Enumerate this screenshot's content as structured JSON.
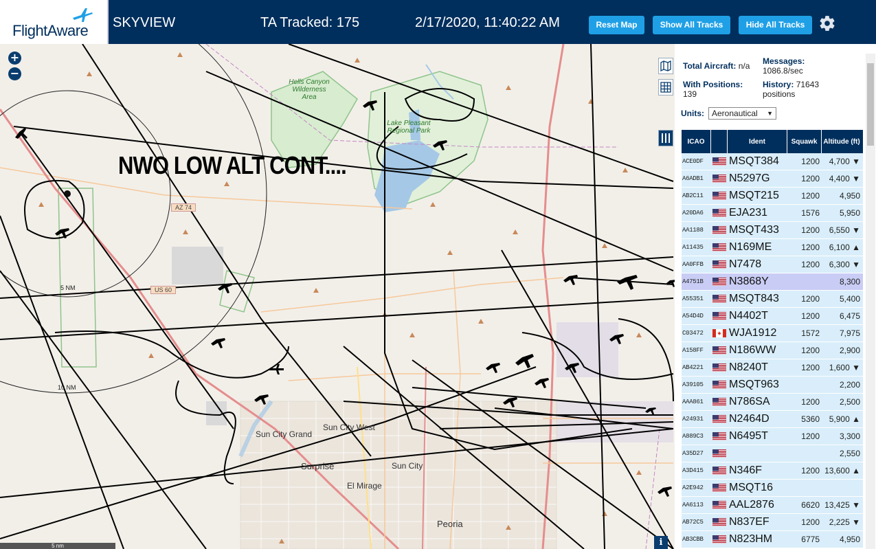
{
  "brand": {
    "name": "FlightAware"
  },
  "header": {
    "app_title": "SKYVIEW",
    "tracked": "TA Tracked: 175",
    "datetime": "2/17/2020, 11:40:22 AM",
    "buttons": {
      "reset": "Reset Map",
      "show": "Show All Tracks",
      "hide": "Hide All Tracks"
    }
  },
  "map": {
    "annotation": "NWO LOW ALT CONT....",
    "zoom_in": "+",
    "zoom_out": "−",
    "places": {
      "sun_city_grand": "Sun City Grand",
      "sun_city_west": "Sun City West",
      "surprise": "Surprise",
      "sun_city": "Sun City",
      "el_mirage": "El Mirage",
      "peoria": "Peoria"
    },
    "parks": {
      "hells_canyon": "Hells Canyon Wilderness Area",
      "lake_pleasant": "Lake Pleasant Regional Park"
    },
    "range_rings": {
      "five": "5 NM",
      "ten": "10 NM"
    },
    "shields": {
      "az74": "AZ 74",
      "us60": "US 60"
    },
    "scale": "5 nm",
    "info": "i"
  },
  "sidebar": {
    "total_aircraft_label": "Total Aircraft:",
    "total_aircraft_value": "n/a",
    "with_positions_label": "With Positions:",
    "with_positions_value": "139",
    "messages_label": "Messages:",
    "messages_value": "1086.8/sec",
    "history_label": "History:",
    "history_value": "71643 positions",
    "units_label": "Units:",
    "units_value": "Aeronautical",
    "columns": {
      "icao": "ICAO",
      "ident": "Ident",
      "squawk": "Squawk",
      "altitude": "Altitude (ft)"
    },
    "rows": [
      {
        "icao": "ACE0DF",
        "flag": "us",
        "ident": "MSQT384",
        "squawk": "1200",
        "alt": "4,700 ▼"
      },
      {
        "icao": "A6ADB1",
        "flag": "us",
        "ident": "N5297G",
        "squawk": "1200",
        "alt": "4,400 ▼"
      },
      {
        "icao": "AB2C11",
        "flag": "us",
        "ident": "MSQT215",
        "squawk": "1200",
        "alt": "4,950"
      },
      {
        "icao": "A20DA6",
        "flag": "us",
        "ident": "EJA231",
        "squawk": "1576",
        "alt": "5,950"
      },
      {
        "icao": "AA1188",
        "flag": "us",
        "ident": "MSQT433",
        "squawk": "1200",
        "alt": "6,550 ▼"
      },
      {
        "icao": "A11435",
        "flag": "us",
        "ident": "N169ME",
        "squawk": "1200",
        "alt": "6,100 ▲"
      },
      {
        "icao": "AA0FFB",
        "flag": "us",
        "ident": "N7478",
        "squawk": "1200",
        "alt": "6,300 ▼"
      },
      {
        "icao": "A4751B",
        "flag": "us",
        "ident": "N3868Y",
        "squawk": "",
        "alt": "8,300",
        "selected": true
      },
      {
        "icao": "A55351",
        "flag": "us",
        "ident": "MSQT843",
        "squawk": "1200",
        "alt": "5,400"
      },
      {
        "icao": "A54D4D",
        "flag": "us",
        "ident": "N4402T",
        "squawk": "1200",
        "alt": "6,475"
      },
      {
        "icao": "C03472",
        "flag": "ca",
        "ident": "WJA1912",
        "squawk": "1572",
        "alt": "7,975"
      },
      {
        "icao": "A158FF",
        "flag": "us",
        "ident": "N186WW",
        "squawk": "1200",
        "alt": "2,900"
      },
      {
        "icao": "AB4221",
        "flag": "us",
        "ident": "N8240T",
        "squawk": "1200",
        "alt": "1,600 ▼"
      },
      {
        "icao": "A39105",
        "flag": "us",
        "ident": "MSQT963",
        "squawk": "",
        "alt": "2,200"
      },
      {
        "icao": "AAA861",
        "flag": "us",
        "ident": "N786SA",
        "squawk": "1200",
        "alt": "2,500"
      },
      {
        "icao": "A24931",
        "flag": "us",
        "ident": "N2464D",
        "squawk": "5360",
        "alt": "5,900 ▲"
      },
      {
        "icao": "A889C3",
        "flag": "us",
        "ident": "N6495T",
        "squawk": "1200",
        "alt": "3,300"
      },
      {
        "icao": "A35D27",
        "flag": "us",
        "ident": "",
        "squawk": "",
        "alt": "2,550"
      },
      {
        "icao": "A3D415",
        "flag": "us",
        "ident": "N346F",
        "squawk": "1200",
        "alt": "13,600 ▲"
      },
      {
        "icao": "A2E942",
        "flag": "us",
        "ident": "MSQT16",
        "squawk": "",
        "alt": ""
      },
      {
        "icao": "AA6113",
        "flag": "us",
        "ident": "AAL2876",
        "squawk": "6620",
        "alt": "13,425 ▼"
      },
      {
        "icao": "AB72C5",
        "flag": "us",
        "ident": "N837EF",
        "squawk": "1200",
        "alt": "2,225 ▼"
      },
      {
        "icao": "AB3CBB",
        "flag": "us",
        "ident": "N823HM",
        "squawk": "6775",
        "alt": "4,950"
      }
    ]
  }
}
